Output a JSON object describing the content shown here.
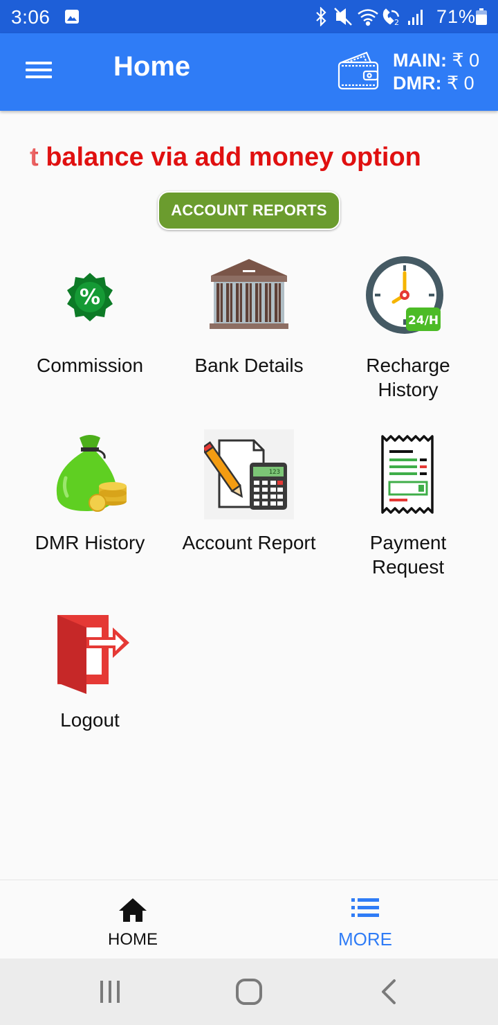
{
  "status_bar": {
    "time": "3:06",
    "battery_percent": "71%",
    "icons": [
      "gallery-icon",
      "bluetooth-icon",
      "mute-icon",
      "wifi-icon",
      "wifi-call-icon",
      "signal-icon",
      "battery-icon"
    ]
  },
  "app_bar": {
    "title": "Home",
    "main_label": "MAIN:",
    "main_value": "₹ 0",
    "dmr_label": "DMR:",
    "dmr_value": "₹ 0",
    "menu_icon": "hamburger-menu-icon",
    "wallet_icon": "wallet-icon"
  },
  "marquee": {
    "text": "t balance via add money option"
  },
  "reports_button": {
    "label": "ACCOUNT REPORTS"
  },
  "grid": {
    "items": [
      {
        "label": "Commission",
        "icon": "percent-badge-icon"
      },
      {
        "label": "Bank Details",
        "icon": "bank-building-icon"
      },
      {
        "label": "Recharge History",
        "icon": "clock-24h-icon"
      },
      {
        "label": "DMR History",
        "icon": "money-bag-icon"
      },
      {
        "label": "Account Report",
        "icon": "calculator-document-icon"
      },
      {
        "label": "Payment Request",
        "icon": "receipt-icon"
      },
      {
        "label": "Logout",
        "icon": "logout-door-icon"
      }
    ]
  },
  "bottom_nav": {
    "items": [
      {
        "label": "HOME",
        "icon": "home-icon"
      },
      {
        "label": "MORE",
        "icon": "list-icon"
      }
    ],
    "active": "MORE"
  },
  "system_nav": {
    "buttons": [
      "recent-apps-icon",
      "home-circle-icon",
      "back-icon"
    ]
  },
  "colors": {
    "status_bar": "#1e5fd8",
    "app_bar": "#2f7cf6",
    "marquee_text": "#e01010",
    "reports_button": "#6b9c2e",
    "active_nav": "#2f7cf6"
  }
}
